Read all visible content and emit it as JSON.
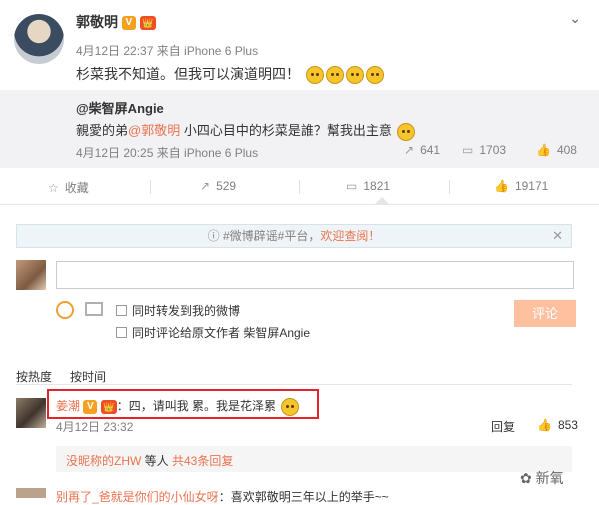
{
  "post": {
    "author": "郭敬明",
    "verified_badge": "V",
    "crown_badge": "👑",
    "chevron": "⌄",
    "meta": "4月12日 22:37 来自 iPhone 6 Plus",
    "text": "杉菜我不知道。但我可以演道明四！"
  },
  "repost": {
    "author": "@柴智屏Angie",
    "text_prefix": "親愛的弟",
    "text_mention": "@郭敬明",
    "text_suffix": " 小四心目中的杉菜是誰？幫我出主意",
    "meta": "4月12日 20:25 来自 iPhone 6 Plus",
    "repost_count": "641",
    "comment_count": "1703",
    "like_count": "408"
  },
  "actions": {
    "favorite_label": "收藏",
    "repost_count": "529",
    "comment_count": "1821",
    "like_count": "19171"
  },
  "comment_box": {
    "notice_prefix": "#微博辟谣#平台，",
    "notice_link": "欢迎查阅！",
    "notice_close": "✕",
    "option_repost": "同时转发到我的微博",
    "option_original": "同时评论给原文作者 柴智屏Angie",
    "submit_label": "评论"
  },
  "sort": {
    "by_hot": "按热度",
    "by_time": "按时间"
  },
  "comment": {
    "user": "姜潮",
    "text": "：四，请叫我 累。我是花泽累",
    "time": "4月12日 23:32",
    "reply_label": "回复",
    "like_count": "853",
    "sub_user": "没昵称的ZHW",
    "sub_middle": " 等人 ",
    "sub_link": "共43条回复"
  },
  "next_comment": {
    "user": "别再了_爸就是你们的小仙女呀",
    "text": "：喜欢郭敬明三年以上的举手~~"
  },
  "watermark": "新氧"
}
